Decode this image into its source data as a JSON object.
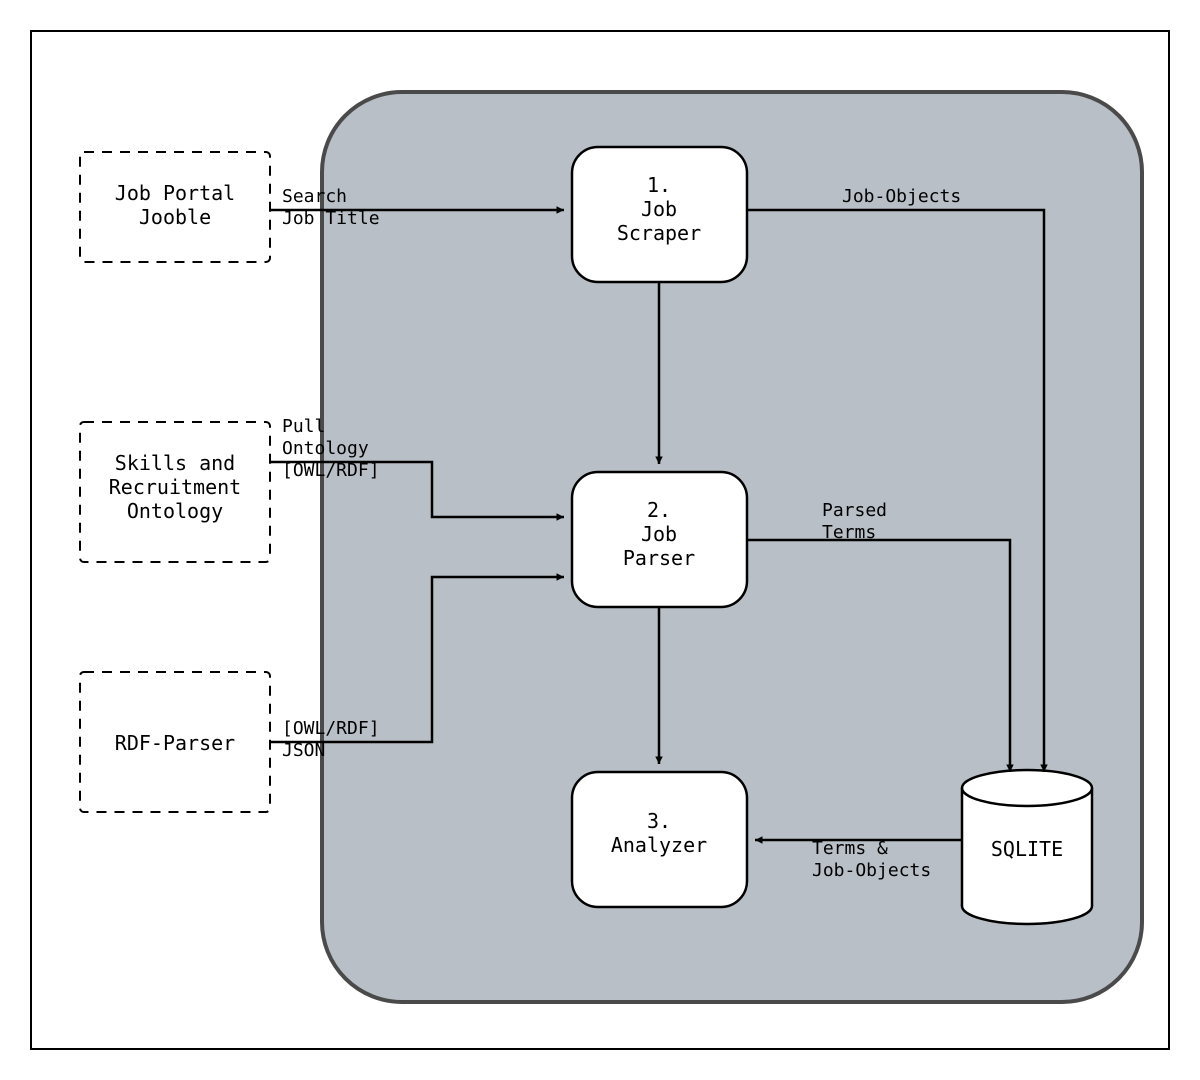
{
  "external": {
    "jobPortal": {
      "line1": "Job Portal",
      "line2": "Jooble"
    },
    "ontology": {
      "line1": "Skills and",
      "line2": "Recruitment",
      "line3": "Ontology"
    },
    "rdfParser": "RDF-Parser"
  },
  "nodes": {
    "scraper": {
      "num": "1.",
      "l1": "Job",
      "l2": "Scraper"
    },
    "parser": {
      "num": "2.",
      "l1": "Job",
      "l2": "Parser"
    },
    "analyzer": {
      "num": "3.",
      "l1": "Analyzer"
    },
    "db": "SQLITE"
  },
  "edges": {
    "search": {
      "l1": "Search",
      "l2": "Job Title"
    },
    "jobObjects": "Job-Objects",
    "pullOnt": {
      "l1": "Pull",
      "l2": "Ontology",
      "l3": "[OWL/RDF]"
    },
    "rdfJson": {
      "l1": "[OWL/RDF]",
      "l2": "JSON"
    },
    "parsedTerms": {
      "l1": "Parsed",
      "l2": "Terms"
    },
    "termsJobs": {
      "l1": "Terms &",
      "l2": "Job-Objects"
    }
  }
}
